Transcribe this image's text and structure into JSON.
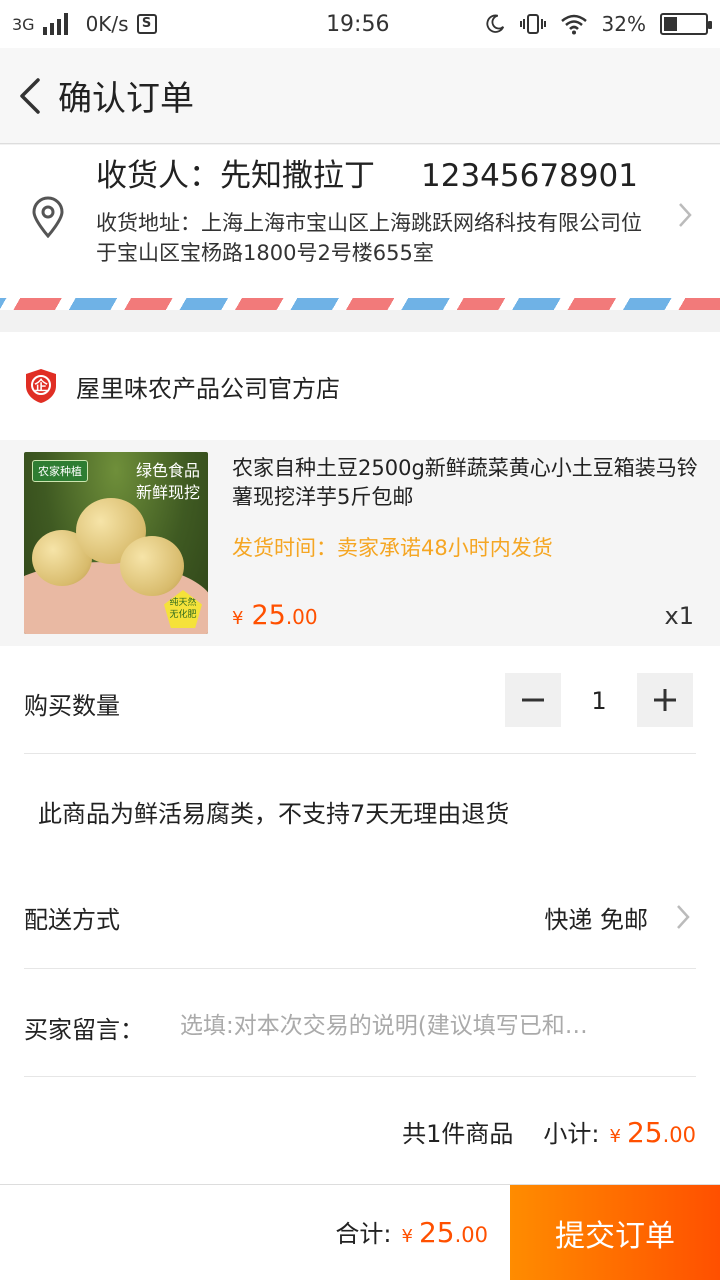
{
  "status_bar": {
    "network": "3G",
    "speed": "0K/s",
    "time": "19:56",
    "battery": "32%",
    "battery_level": 0.32
  },
  "header": {
    "title": "确认订单",
    "back_icon": "chevron-left-icon"
  },
  "address": {
    "receiver_label": "收货人：先知撒拉丁",
    "phone": "12345678901",
    "address_text": "收货地址：上海上海市宝山区上海跳跃网络科技有限公司位于宝山区宝杨路1800号2号楼655室",
    "pin_icon": "location-pin-icon"
  },
  "shop": {
    "name": "屋里味农产品公司官方店",
    "icon": "enterprise-badge-icon"
  },
  "product": {
    "title": "农家自种土豆2500g新鲜蔬菜黄心小土豆箱装马铃薯现挖洋芋5斤包邮",
    "ship_time": "发货时间：卖家承诺48小时内发货",
    "currency": "¥",
    "price_int": "25",
    "price_dec": ".00",
    "quantity": "x1",
    "image_tag": "农家种植",
    "image_slogan_1": "绿色食品",
    "image_slogan_2": "新鲜现挖",
    "image_seal_1": "纯天然",
    "image_seal_2": "无化肥"
  },
  "quantity": {
    "label": "购买数量",
    "value": "1",
    "minus": "−",
    "plus": "+"
  },
  "notice": "此商品为鲜活易腐类，不支持7天无理由退货",
  "delivery": {
    "label": "配送方式",
    "value": "快递 免邮"
  },
  "message": {
    "label": "买家留言：",
    "placeholder": "选填:对本次交易的说明(建议填写已和…"
  },
  "summary": {
    "count": "共1件商品",
    "subtotal_label": "小计:",
    "currency": "¥",
    "int": "25",
    "dec": ".00"
  },
  "footer": {
    "total_label": "合计:",
    "currency": "¥",
    "int": "25",
    "dec": ".00",
    "submit_label": "提交订单"
  },
  "colors": {
    "accent": "#ff5000",
    "ship_time": "#f5a623",
    "airmail_red": "#f27a7a",
    "airmail_blue": "#6fb2e6"
  }
}
